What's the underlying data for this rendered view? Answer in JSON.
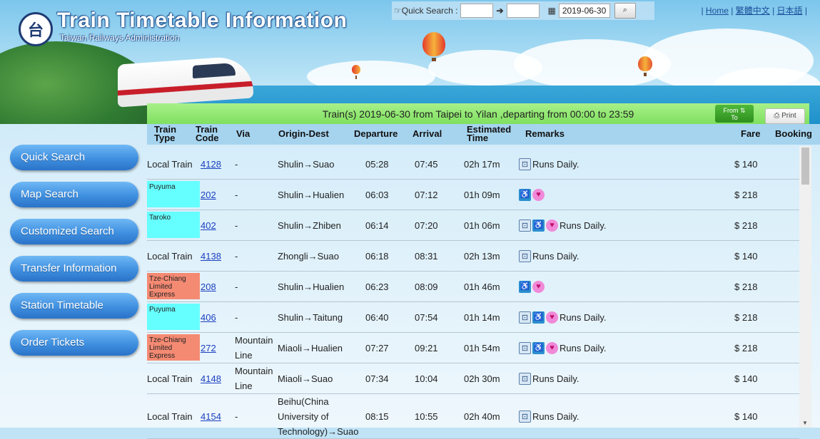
{
  "header": {
    "title": "Train Timetable Information",
    "subtitle": "Taiwan Railways Administration",
    "logo_glyph": "台"
  },
  "quick_search": {
    "label": "Quick Search :",
    "from_value": "",
    "to_value": "",
    "date": "2019-06-30"
  },
  "languages": {
    "home": "Home",
    "zh": "繁體中文",
    "ja": "日本語"
  },
  "banner": {
    "text": "Train(s) 2019-06-30 from Taipei to Yilan ,departing from 00:00 to 23:59",
    "from_to_label_1": "From ⇅",
    "from_to_label_2": "To",
    "print_label": "⎙ Print"
  },
  "sidebar": {
    "items": [
      {
        "label": "Quick Search"
      },
      {
        "label": "Map Search"
      },
      {
        "label": "Customized Search"
      },
      {
        "label": "Transfer Information"
      },
      {
        "label": "Station Timetable"
      },
      {
        "label": "Order Tickets"
      }
    ]
  },
  "table": {
    "headers": {
      "train_type": "Train\nType",
      "train_code": "Train\nCode",
      "via": "Via",
      "origin_dest": "Origin-Dest",
      "departure": "Departure",
      "arrival": "Arrival",
      "estimated_time": "Estimated\nTime",
      "remarks": "Remarks",
      "fare": "Fare",
      "booking": "Booking"
    },
    "rows": [
      {
        "type": "Local Train",
        "type_style": "plain",
        "code": "4128",
        "via": "-",
        "od": "Shulin→Suao",
        "dep": "05:28",
        "arr": "07:45",
        "est": "02h 17m",
        "icons": [
          "daily"
        ],
        "remark": "Runs Daily.",
        "fare": "$ 140"
      },
      {
        "type": "Puyuma",
        "type_style": "puyuma",
        "code": "202",
        "via": "-",
        "od": "Shulin→Hualien",
        "dep": "06:03",
        "arr": "07:12",
        "est": "01h 09m",
        "icons": [
          "wheel",
          "baby"
        ],
        "remark": "",
        "fare": "$ 218"
      },
      {
        "type": "Taroko",
        "type_style": "taroko",
        "code": "402",
        "via": "-",
        "od": "Shulin→Zhiben",
        "dep": "06:14",
        "arr": "07:20",
        "est": "01h 06m",
        "icons": [
          "daily",
          "wheel",
          "baby"
        ],
        "remark": "Runs Daily.",
        "fare": "$ 218"
      },
      {
        "type": "Local Train",
        "type_style": "plain",
        "code": "4138",
        "via": "-",
        "od": "Zhongli→Suao",
        "dep": "06:18",
        "arr": "08:31",
        "est": "02h 13m",
        "icons": [
          "daily"
        ],
        "remark": "Runs Daily.",
        "fare": "$ 140"
      },
      {
        "type": "Tze-Chiang Limited Express",
        "type_style": "tze",
        "code": "208",
        "via": "-",
        "od": "Shulin→Hualien",
        "dep": "06:23",
        "arr": "08:09",
        "est": "01h 46m",
        "icons": [
          "wheel",
          "baby"
        ],
        "remark": "",
        "fare": "$ 218"
      },
      {
        "type": "Puyuma",
        "type_style": "puyuma",
        "code": "406",
        "via": "-",
        "od": "Shulin→Taitung",
        "dep": "06:40",
        "arr": "07:54",
        "est": "01h 14m",
        "icons": [
          "daily",
          "wheel",
          "baby"
        ],
        "remark": "Runs Daily.",
        "fare": "$ 218"
      },
      {
        "type": "Tze-Chiang Limited Express",
        "type_style": "tze",
        "code": "272",
        "via": "Mountain Line",
        "od": "Miaoli→Hualien",
        "dep": "07:27",
        "arr": "09:21",
        "est": "01h 54m",
        "icons": [
          "daily",
          "wheel",
          "baby"
        ],
        "remark": "Runs Daily.",
        "fare": "$ 218"
      },
      {
        "type": "Local Train",
        "type_style": "plain",
        "code": "4148",
        "via": "Mountain Line",
        "od": "Miaoli→Suao",
        "dep": "07:34",
        "arr": "10:04",
        "est": "02h 30m",
        "icons": [
          "daily"
        ],
        "remark": "Runs Daily.",
        "fare": "$ 140"
      },
      {
        "type": "Local Train",
        "type_style": "plain",
        "code": "4154",
        "via": "-",
        "od": "Beihu(China University of Technology)→Suao",
        "dep": "08:15",
        "arr": "10:55",
        "est": "02h 40m",
        "icons": [
          "daily"
        ],
        "remark": "Runs Daily.",
        "fare": "$ 140"
      }
    ]
  },
  "colors": {
    "banner_green": "#7fe05f",
    "header_blue": "#a6d4ef",
    "puyuma": "#66ffff",
    "tze_chiang": "#f58a73",
    "sidebar_button": "#3f8fe0"
  },
  "icon_names": {
    "daily": "train-daily-icon",
    "wheel": "wheelchair-icon",
    "baby": "baby-care-icon"
  }
}
